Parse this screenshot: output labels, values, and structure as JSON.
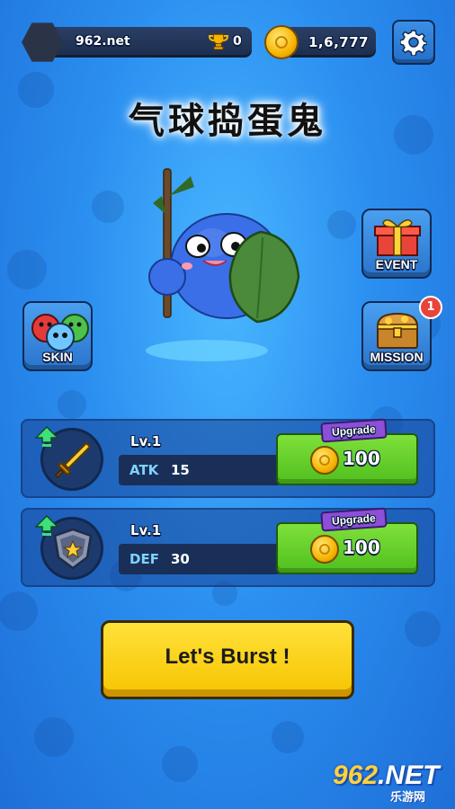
{
  "top_bar": {
    "player_name": "962.net",
    "trophy_count": "0",
    "coin_count": "1,6,777"
  },
  "title": "气球捣蛋鬼",
  "side_buttons": {
    "event_label": "EVENT",
    "skin_label": "SKIN",
    "mission_label": "MISSION",
    "mission_badge": "1"
  },
  "stats": [
    {
      "level": "Lv.1",
      "name": "ATK",
      "value": "15",
      "upgrade_label": "Upgrade",
      "cost": "100"
    },
    {
      "level": "Lv.1",
      "name": "DEF",
      "value": "30",
      "upgrade_label": "Upgrade",
      "cost": "100"
    }
  ],
  "burst_button": "Let's Burst !",
  "watermark": {
    "main_prefix": "962",
    "main_suffix": ".NET",
    "sub": "乐游网"
  },
  "colors": {
    "background": "#2b8ff0",
    "upgrade_green": "#4fbf1e",
    "burst_yellow": "#f6c400",
    "badge_red": "#e8443a"
  },
  "icons": [
    "settings-gear-icon",
    "trophy-icon",
    "coin-icon",
    "gift-box-icon",
    "treasure-chest-icon",
    "balloon-trio-icon",
    "sword-icon",
    "shield-icon",
    "up-arrow-icon"
  ]
}
